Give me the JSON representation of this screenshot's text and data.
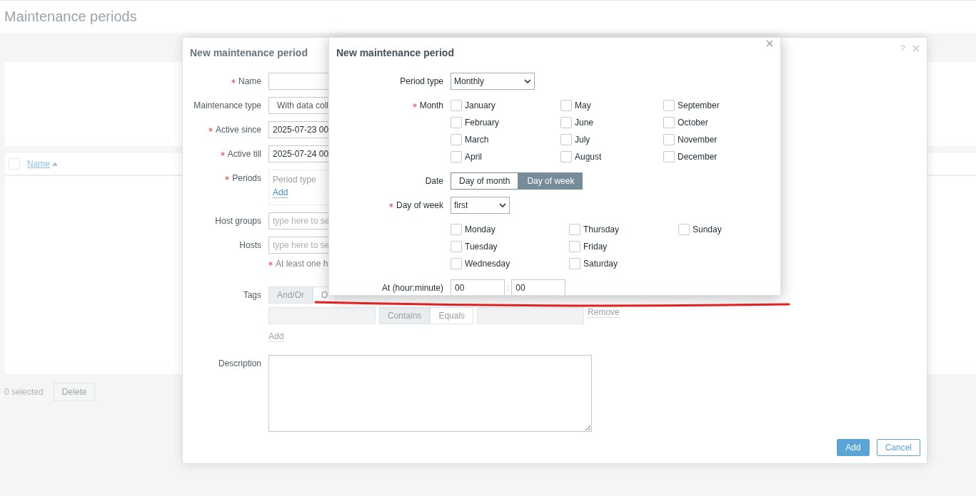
{
  "page": {
    "title": "Maintenance periods",
    "table": {
      "select_all": {
        "checked": false
      },
      "columns": [
        {
          "label": "Name",
          "sorted_ascending": true
        }
      ]
    },
    "footer": {
      "selected_count": "0 selected",
      "buttons": [
        {
          "label": "Delete",
          "disabled": true
        }
      ]
    }
  },
  "dialog": {
    "title": "New maintenance period",
    "help": "?",
    "fields": [
      {
        "kind": "text",
        "label": "Name",
        "required": true
      },
      {
        "kind": "select",
        "label": "Maintenance type",
        "value": "With data coll"
      },
      {
        "kind": "text",
        "label": "Active since",
        "required": true,
        "value": "2025-07-23 00"
      },
      {
        "kind": "text",
        "label": "Active till",
        "required": true,
        "value": "2025-07-24 00"
      },
      {
        "kind": "periods",
        "label": "Periods",
        "required": true,
        "header": "Period type",
        "add": "Add"
      },
      {
        "kind": "multiselect",
        "label": "Host groups",
        "placeholder": "type here to se"
      },
      {
        "kind": "multiselect",
        "label": "Hosts",
        "placeholder": "type here to se"
      },
      {
        "kind": "note",
        "required": true,
        "text": "At least one h"
      },
      {
        "kind": "tags",
        "label": "Tags",
        "disabled": true,
        "operators": [
          {
            "label": "And/Or",
            "selected": true
          },
          {
            "label": "O",
            "selected": false
          }
        ],
        "rows": [
          {
            "conditions": [
              {
                "label": "Contains",
                "selected": true
              },
              {
                "label": "Equals",
                "selected": false
              }
            ],
            "remove": "Remove"
          }
        ],
        "add": "Add"
      },
      {
        "kind": "textarea",
        "label": "Description"
      }
    ],
    "buttons": [
      {
        "label": "Add",
        "primary": true
      },
      {
        "label": "Cancel",
        "primary": false
      }
    ]
  },
  "period_dialog": {
    "title": "New maintenance period",
    "period_type": {
      "label": "Period type",
      "value": "Monthly"
    },
    "month": {
      "label": "Month",
      "required": true,
      "options": [
        {
          "label": "January",
          "checked": false
        },
        {
          "label": "February",
          "checked": false
        },
        {
          "label": "March",
          "checked": false
        },
        {
          "label": "April",
          "checked": false
        },
        {
          "label": "May",
          "checked": false
        },
        {
          "label": "June",
          "checked": false
        },
        {
          "label": "July",
          "checked": false
        },
        {
          "label": "August",
          "checked": false
        },
        {
          "label": "September",
          "checked": false
        },
        {
          "label": "October",
          "checked": false
        },
        {
          "label": "November",
          "checked": false
        },
        {
          "label": "December",
          "checked": false
        }
      ]
    },
    "date": {
      "label": "Date",
      "options": [
        {
          "label": "Day of month",
          "selected": false
        },
        {
          "label": "Day of week",
          "selected": true
        }
      ]
    },
    "day_of_week": {
      "label": "Day of week",
      "required": true,
      "value": "first",
      "days": [
        {
          "label": "Monday",
          "checked": false
        },
        {
          "label": "Tuesday",
          "checked": false
        },
        {
          "label": "Wednesday",
          "checked": false
        },
        {
          "label": "Thursday",
          "checked": false
        },
        {
          "label": "Friday",
          "checked": false
        },
        {
          "label": "Saturday",
          "checked": false
        },
        {
          "label": "Sunday",
          "checked": false
        }
      ]
    },
    "time": {
      "label": "At (hour:minute)",
      "hour": "00",
      "separator": ":",
      "minute": "00"
    }
  }
}
